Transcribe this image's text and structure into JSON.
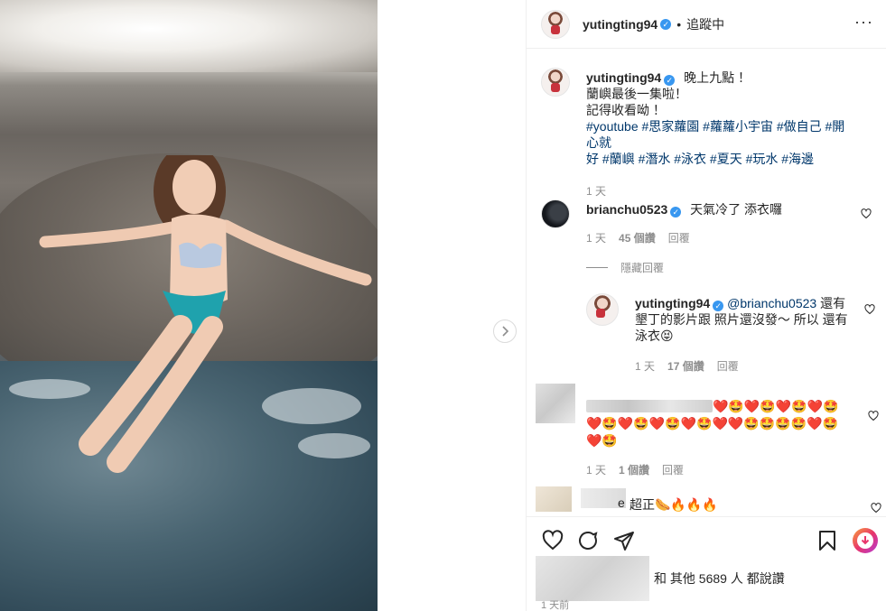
{
  "post": {
    "author": "yutingting94",
    "follow_status": "追蹤中",
    "dot": "•",
    "more": "···"
  },
  "caption": {
    "author": "yutingting94",
    "line1": "晚上九點 ！",
    "line2": "蘭嶼最後一集啦！",
    "line3": "記得收看呦 ！",
    "hashtags_line1": "#youtube #思家蘿園 #蘿蘿小宇宙 #做自己 #開心就",
    "hashtags_line2": "好 #蘭嶼 #潛水 #泳衣 #夏天 #玩水 #海邊",
    "time": "1 天"
  },
  "comments": [
    {
      "author": "brianchu0523",
      "text": "天氣冷了 添衣囉",
      "time": "1 天",
      "likes": "45 個讚",
      "reply": "回覆",
      "hide_replies": "隱藏回覆"
    },
    {
      "author": "yutingting94",
      "mention": "@brianchu0523",
      "text_line1": " 還有",
      "text_line2": "墾丁的影片跟 照片還沒發～ 所以 還有",
      "text_line3": "泳衣😝",
      "time": "1 天",
      "likes": "17 個讚",
      "reply": "回覆"
    },
    {
      "emoji_line1": "❤️🤩❤️🤩❤️🤩❤️🤩",
      "emoji_line2": "❤️🤩❤️🤩❤️🤩❤️🤩❤️❤️🤩🤩🤩🤩❤️🤩",
      "emoji_line3": "❤️🤩",
      "time": "1 天",
      "likes": "1 個讚",
      "reply": "回覆"
    },
    {
      "suffix": "e",
      "text": "超正🌭🔥🔥🔥"
    }
  ],
  "likes_summary": "和 其他 5689 人 都說讚",
  "posted": "1 天前",
  "icons": [
    "heart-icon",
    "comment-icon",
    "share-icon",
    "bookmark-icon",
    "download-icon",
    "chevron-right-icon",
    "verified-badge-icon"
  ]
}
